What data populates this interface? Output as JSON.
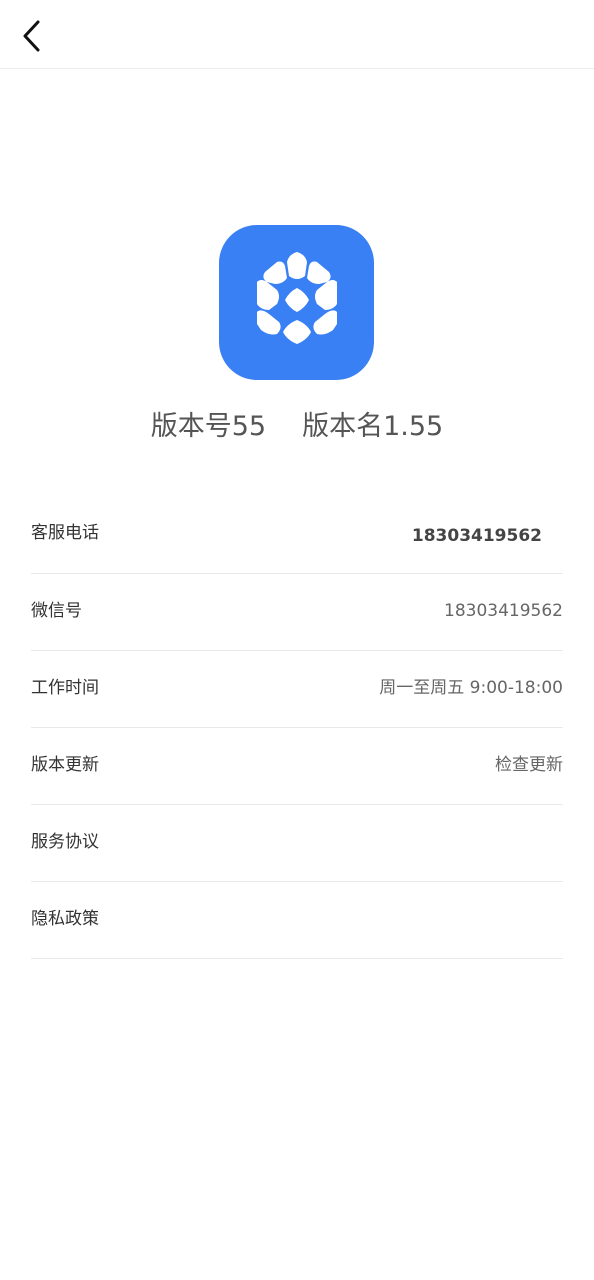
{
  "header": {
    "back_icon": "chevron-left-icon"
  },
  "app": {
    "logo_icon": "cube-logo-icon",
    "brand_color": "#3a80f5",
    "version_code_label": "版本号55",
    "version_name_label": "版本名1.55"
  },
  "info": {
    "rows": [
      {
        "label": "客服电话",
        "value": "18303419562"
      },
      {
        "label": "微信号",
        "value": "18303419562"
      },
      {
        "label": "工作时间",
        "value": "周一至周五 9:00-18:00"
      },
      {
        "label": "版本更新",
        "value": "检查更新"
      },
      {
        "label": "服务协议",
        "value": ""
      },
      {
        "label": "隐私政策",
        "value": ""
      }
    ]
  }
}
